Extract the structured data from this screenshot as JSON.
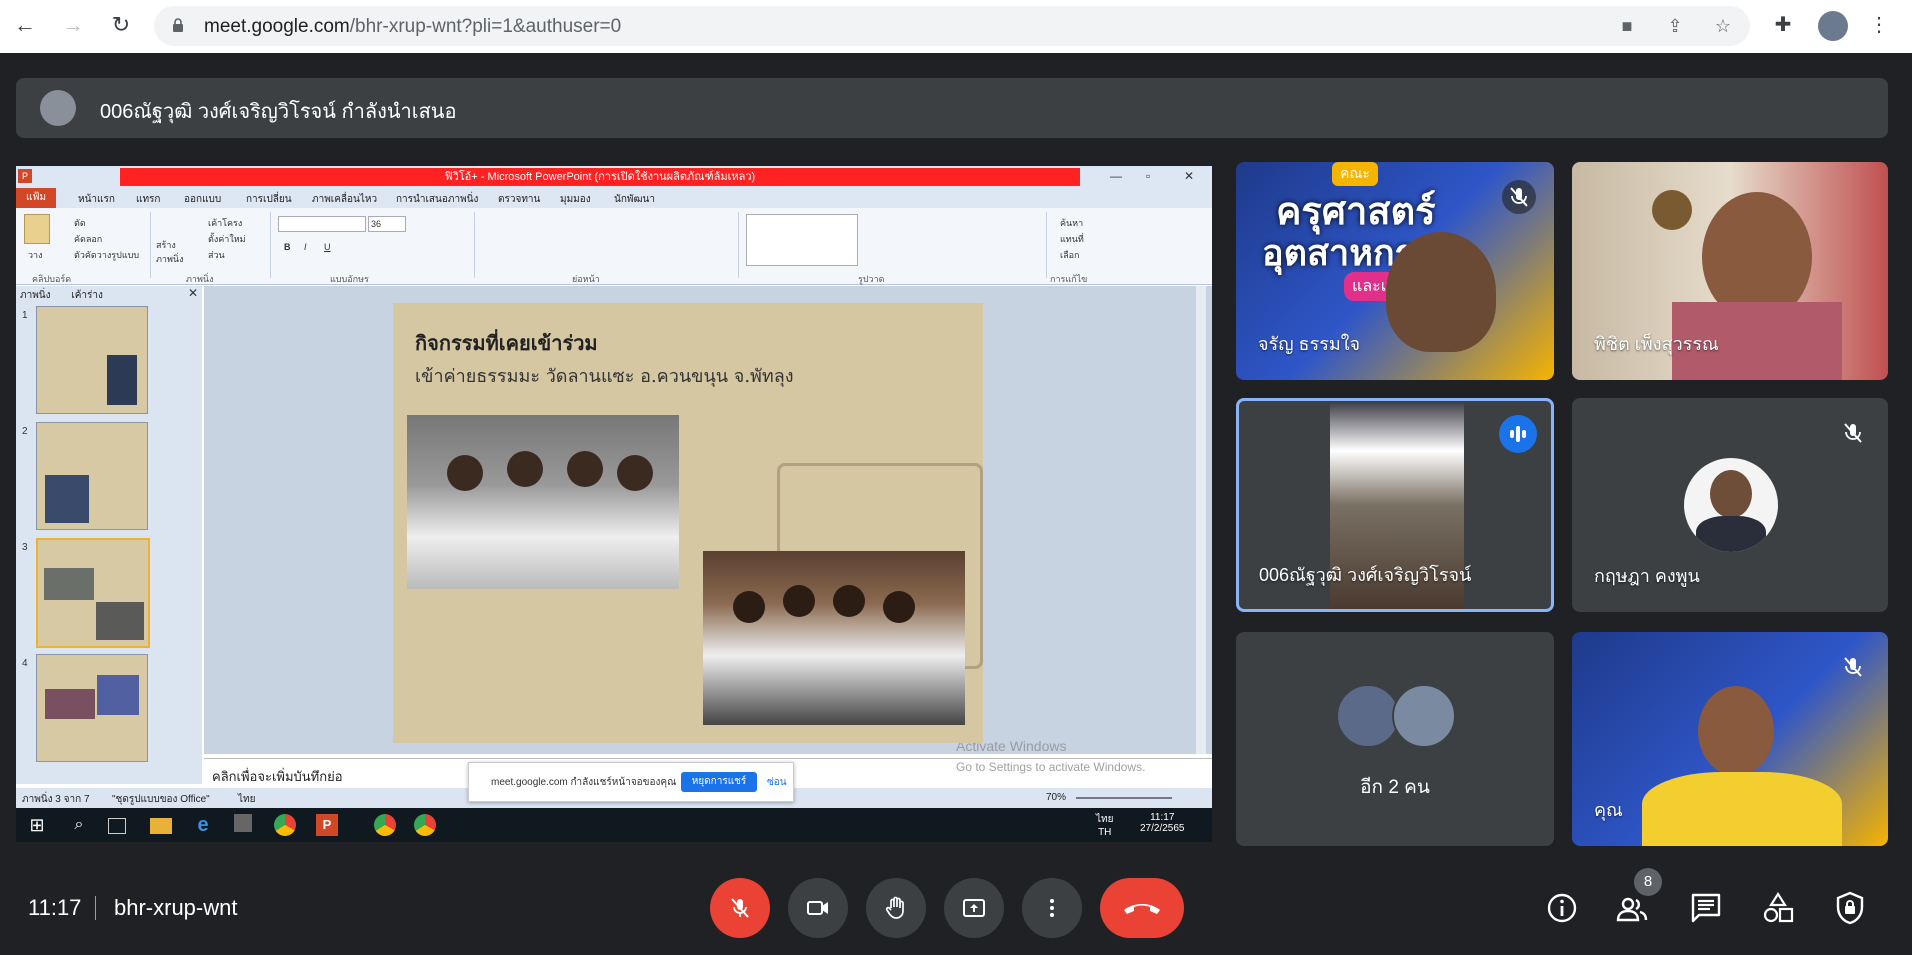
{
  "browser": {
    "url_host": "meet.google.com",
    "url_path": "/bhr-xrup-wnt?pli=1&authuser=0"
  },
  "presenter_banner": {
    "text": "006ณัฐวุฒิ วงศ์เจริญวิโรจน์ กำลังนำเสนอ"
  },
  "powerpoint": {
    "title": "ฟิวิโอ้+ - Microsoft PowerPoint (การเปิดใช้งานผลิตภัณฑ์ล้มเหลว)",
    "file_tab": "แฟ้ม",
    "tabs": [
      "หน้าแรก",
      "แทรก",
      "ออกแบบ",
      "การเปลี่ยน",
      "ภาพเคลื่อนไหว",
      "การนำเสนอภาพนิ่ง",
      "ตรวจทาน",
      "มุมมอง",
      "นักพัฒนา"
    ],
    "groups": [
      "คลิปบอร์ด",
      "ภาพนิ่ง",
      "แบบอักษร",
      "ย่อหน้า",
      "รูปวาด",
      "การแก้ไข"
    ],
    "clipboard": {
      "cut": "ตัด",
      "copy": "คัดลอก",
      "format_painter": "ตัวคัดวางรูปแบบ",
      "paste": "วาง"
    },
    "slides_group": {
      "new_slide": "สร้างภาพนิ่ง",
      "layout": "เค้าโครง",
      "reset": "ตั้งค่าใหม่",
      "section": "ส่วน"
    },
    "font_size": "36",
    "editing": {
      "find": "ค้นหา",
      "replace": "แทนที่",
      "select": "เลือก"
    },
    "pane_tabs": [
      "ภาพนิ่ง",
      "เค้าร่าง"
    ],
    "thumb_numbers": [
      "1",
      "2",
      "3",
      "4"
    ],
    "slide": {
      "heading": "กิจกรรมที่เคยเข้าร่วม",
      "subheading": "เข้าค่ายธรรมมะ วัดลานแซะ อ.ควนขนุน จ.พัทลุง"
    },
    "notes_placeholder": "คลิกเพื่อจะเพิ่มบันทึกย่อ",
    "status_left": "ภาพนิ่ง 3 จาก 7",
    "status_theme": "\"ชุดรูปแบบของ Office\"",
    "status_lang": "ไทย",
    "zoom": "70%",
    "watermark_line1": "Activate Windows",
    "watermark_line2": "Go to Settings to activate Windows.",
    "taskbar_time": "11:17",
    "taskbar_date": "27/2/2565",
    "taskbar_lang_top": "ไทย",
    "taskbar_lang_bottom": "TH"
  },
  "share_notice": {
    "text": "meet.google.com กำลังแชร์หน้าจอของคุณ",
    "stop_label": "หยุดการแชร์",
    "hide_label": "ซ่อน"
  },
  "participants": [
    {
      "name": "จรัญ ธรรมใจ",
      "muted": true
    },
    {
      "name": "พิชิต เพ็งสุวรรณ",
      "muted": false
    },
    {
      "name": "006ณัฐวุฒิ วงศ์เจริญวิโรจน์",
      "speaking": true
    },
    {
      "name": "กฤษฎา คงพูน",
      "muted": true
    },
    {
      "name": "อีก 2 คน"
    },
    {
      "name": "คุณ",
      "muted": true
    }
  ],
  "tile_banner_text": {
    "top_tag": "คณะ",
    "line1": "ครุศาสตร์",
    "line2": "อุตสาหกรรม",
    "line3": "และเทคโ"
  },
  "bottom_bar": {
    "time": "11:17",
    "meeting_code": "bhr-xrup-wnt",
    "participant_count": "8"
  },
  "colors": {
    "meet_bg": "#202124",
    "tile_bg": "#3c4043",
    "end_call": "#ea4335",
    "speaking_border": "#8ab4f8",
    "accent_blue": "#1a73e8"
  }
}
